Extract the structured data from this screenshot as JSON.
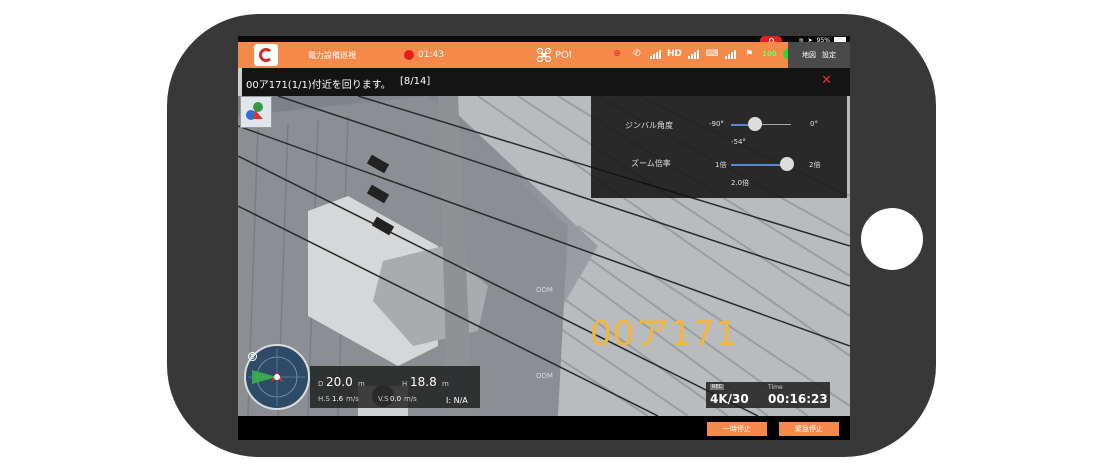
{
  "app": {
    "title": "電力設備巡視",
    "record_time": "01:43",
    "poi_label": "POI",
    "hd_label": "HD",
    "battery_pct": "100",
    "map_label": "地図",
    "settings_label": "設定"
  },
  "message": {
    "text": "00ア171(1/1)付近を回ります。",
    "progress": "[8/14]"
  },
  "gimbal": {
    "angle_label": "ジンバル角度",
    "angle_min": "-90°",
    "angle_max": "0°",
    "angle_value": "-54°",
    "angle_fraction": 0.4,
    "zoom_label": "ズーム倍率",
    "zoom_min": "1倍",
    "zoom_max": "2倍",
    "zoom_value": "2.0倍",
    "zoom_fraction": 1.0
  },
  "overlay": {
    "target_id": "00ア171",
    "odm1": "ODM",
    "odm2": "ODM"
  },
  "telemetry": {
    "d_label": "D",
    "d_value": "20.0",
    "d_unit": "m",
    "h_label": "H",
    "h_value": "18.8",
    "h_unit": "m",
    "hs_label": "H.S",
    "hs_value": "1.6",
    "hs_unit": "m/s",
    "vs_label": "V.S",
    "vs_value": "0.0",
    "vs_unit": "m/s",
    "ir_label": "I:",
    "ir_value": "N/A"
  },
  "recording": {
    "tag": "REC",
    "resolution": "4K/30",
    "time_label": "Time",
    "time_value": "00:16:23"
  },
  "buttons": {
    "pause": "一時停止",
    "stop": "緊急停止"
  },
  "ios": {
    "battery": "95%"
  },
  "colors": {
    "accent": "#f4894a",
    "overlay_text": "#f4b63a",
    "close": "#e23232"
  }
}
